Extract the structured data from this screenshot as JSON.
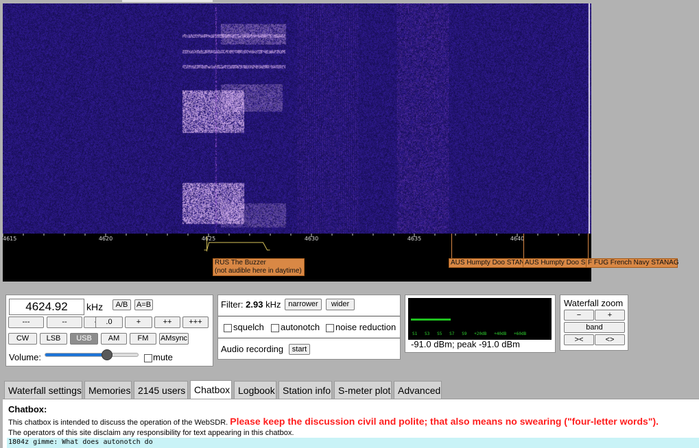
{
  "waterfall": {
    "frequency_ticks": [
      "4615",
      "4620",
      "4625",
      "4630",
      "4635",
      "4640"
    ]
  },
  "stations": [
    {
      "label_lines": [
        "RUS The Buzzer",
        "(not audible here in daytime)"
      ]
    },
    {
      "label_lines": [
        "AUS Humpty Doo STAN"
      ]
    },
    {
      "label_lines": [
        "AUS Humpty Doo S"
      ]
    },
    {
      "label_lines": [
        "F FUG French Navy STANAG"
      ]
    }
  ],
  "tuning": {
    "frequency": "4624.92",
    "unit": "kHz",
    "ab_label": "A/B",
    "aeqb_label": "A=B",
    "steps": [
      "---",
      "--",
      "-",
      ".0",
      "+",
      "++",
      "+++"
    ],
    "modes": [
      "CW",
      "LSB",
      "USB",
      "AM",
      "FM",
      "AMsync"
    ],
    "selected_mode": "USB",
    "volume_label": "Volume:",
    "volume_level": 0.66,
    "mute_label": "mute",
    "mute_checked": false
  },
  "filter": {
    "label": "Filter:",
    "bandwidth": "2.93",
    "unit": "kHz",
    "narrower_label": "narrower",
    "wider_label": "wider",
    "squelch_label": "squelch",
    "autonotch_label": "autonotch",
    "noise_reduction_label": "noise reduction",
    "recording_label": "Audio recording",
    "start_label": "start"
  },
  "smeter": {
    "scale_labels": [
      "S1",
      "S3",
      "S5",
      "S7",
      "S9",
      "+20dB",
      "+40dB",
      "+60dB"
    ],
    "level_fraction": 0.29,
    "readout": "-91.0 dBm; peak  -91.0 dBm"
  },
  "zoom": {
    "title": "Waterfall zoom",
    "minus": "−",
    "plus": "+",
    "band": "band",
    "left": ">< ",
    "right": "<>"
  },
  "tabs": {
    "items": [
      "Waterfall settings",
      "Memories",
      "2145 users",
      "Chatbox",
      "Logbook",
      "Station info",
      "S-meter plot",
      "Advanced"
    ],
    "active": "Chatbox"
  },
  "chatbox": {
    "title": "Chatbox:",
    "intro": "This chatbox is intended to discuss the operation of the WebSDR.",
    "warning": "Please keep the discussion civil and polite; that also means no swearing (\"four-letter words\").",
    "disclaimer": "The operators of this site disclaim any responsibility for text appearing in this chatbox.",
    "messages": [
      "1804z gimme: What does autonotch do"
    ]
  },
  "colors": {
    "waterfall_bg": "#1a1060",
    "signal": "#f0c8ff",
    "station_tag": "#d98845",
    "tuning_marker": "#d7c35a",
    "smeter_bar": "#1fc21f",
    "warning": "#ff1e1e",
    "chat_bg": "#c9f3f7"
  }
}
